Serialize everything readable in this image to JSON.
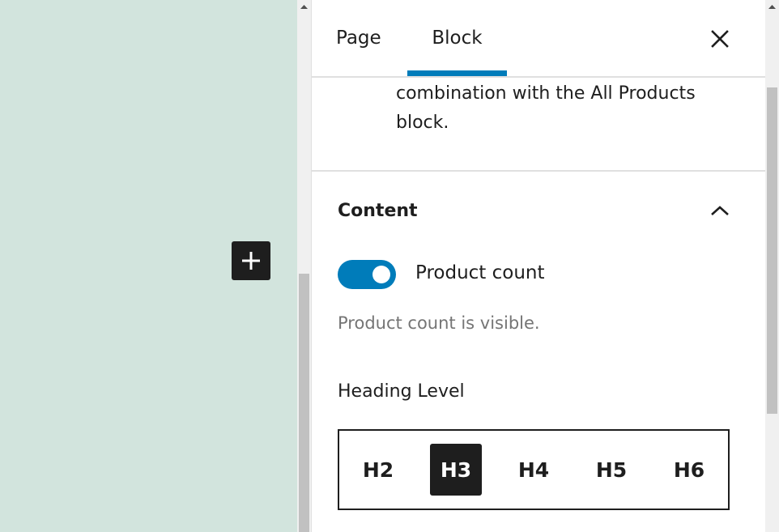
{
  "colors": {
    "accent": "#007cba",
    "canvas_bg": "#d2e4dd",
    "dark": "#1e1e1e",
    "muted_text": "#757575"
  },
  "canvas": {
    "inserter_icon": "plus-icon"
  },
  "sidebar": {
    "tabs": [
      {
        "label": "Page",
        "active": false
      },
      {
        "label": "Block",
        "active": true
      }
    ],
    "close_icon": "close-icon",
    "description_lines": [
      "combination with the All Products",
      "block."
    ],
    "content_panel": {
      "title": "Content",
      "expanded": true,
      "toggle": {
        "label": "Product count",
        "checked": true,
        "help": "Product count is visible."
      },
      "heading_level": {
        "label": "Heading Level",
        "options": [
          "H2",
          "H3",
          "H4",
          "H5",
          "H6"
        ],
        "selected": "H3"
      }
    }
  }
}
